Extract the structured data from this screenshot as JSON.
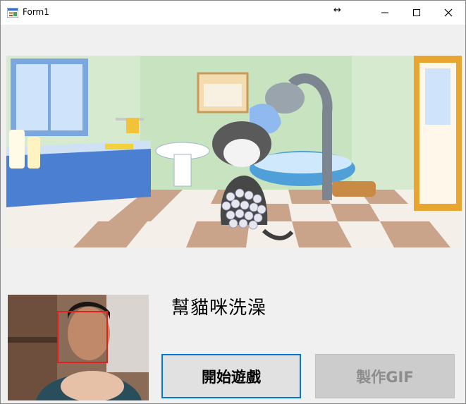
{
  "window": {
    "title": "Form1",
    "minimize_label": "minimize-icon",
    "maximize_label": "maximize-icon",
    "close_label": "close-icon"
  },
  "scene": {
    "name": "bathroom-cat-scene"
  },
  "webcam": {
    "face_box_color": "#e0201c"
  },
  "game": {
    "title": "幫貓咪洗澡"
  },
  "buttons": {
    "start_label": "開始遊戲",
    "gif_label": "製作GIF",
    "start_border_color": "#0078d7"
  }
}
